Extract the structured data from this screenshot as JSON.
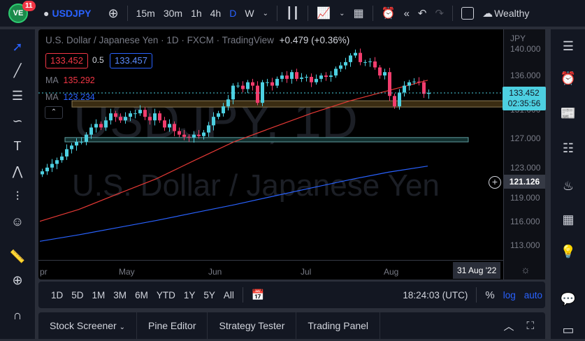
{
  "topbar": {
    "badge": "11",
    "symbol": "USDJPY",
    "intervals": [
      "15m",
      "30m",
      "1h",
      "4h",
      "D",
      "W"
    ],
    "active_interval": "D",
    "user": "Wealthy"
  },
  "legend": {
    "title": "U.S. Dollar / Japanese Yen · 1D · FXCM · TradingView",
    "change": "+0.479 (+0.36%)",
    "bid": "133.452",
    "spread": "0.5",
    "ask": "133.457",
    "ma1_label": "MA",
    "ma1_value": "135.292",
    "ma2_label": "MA",
    "ma2_value": "123.234"
  },
  "watermark": {
    "symbol": "USDJPY, 1D",
    "name": "U.S. Dollar / Japanese Yen"
  },
  "axis": {
    "currency": "JPY",
    "ticks": [
      "140.000",
      "136.000",
      "131.000",
      "127.000",
      "123.000",
      "119.000",
      "116.000",
      "113.000"
    ],
    "last_price": "133.452",
    "countdown": "02:35:56",
    "crosshair_price": "121.126",
    "time_ticks": [
      "pr",
      "May",
      "Jun",
      "Jul",
      "Aug"
    ],
    "time_cursor": "31 Aug '22"
  },
  "rangebar": {
    "ranges": [
      "1D",
      "5D",
      "1M",
      "3M",
      "6M",
      "YTD",
      "1Y",
      "5Y",
      "All"
    ],
    "clock": "18:24:03 (UTC)",
    "percent": "%",
    "log": "log",
    "auto": "auto"
  },
  "tabs": [
    "Stock Screener",
    "Pine Editor",
    "Strategy Tester",
    "Trading Panel"
  ],
  "chart_data": {
    "type": "candlestick",
    "symbol": "USDJPY",
    "timeframe": "1D",
    "colors": {
      "up": "#4dd0e1",
      "down": "#f23d6d",
      "ma_fast": "#e53935",
      "ma_slow": "#2962ff"
    },
    "closes": [
      122.5,
      123,
      123.5,
      124,
      124.5,
      125.5,
      126,
      126.5,
      126.5,
      127.5,
      128.5,
      129,
      128.5,
      129.5,
      130.5,
      130,
      129.5,
      130,
      130.5,
      130.5,
      131,
      130,
      129.5,
      130.5,
      129.5,
      128.5,
      129,
      128,
      127.5,
      127.2,
      127.1,
      127.5,
      127.3,
      127.8,
      128.8,
      130,
      130.5,
      131.5,
      132.5,
      134.5,
      134.5,
      134,
      135,
      134.5,
      132,
      135,
      135,
      134.5,
      135.5,
      136,
      135.5,
      136.5,
      135.5,
      135.7,
      135.8,
      135,
      135.5,
      136,
      135.8,
      136,
      137,
      137.5,
      138,
      139,
      139.4,
      138,
      138,
      138.1,
      137.2,
      136,
      136.5,
      133,
      131.5,
      133.5,
      134.5,
      135,
      135.1,
      135,
      133.3,
      133.45
    ],
    "ma_fast": [
      116,
      117.5,
      119.5,
      121.5,
      124,
      126.5,
      128.5,
      130.5,
      132.3,
      133.8,
      135.3
    ],
    "ma_slow": [
      113.5,
      114.3,
      115.2,
      116.1,
      117.1,
      118.1,
      119.2,
      120.3,
      121.4,
      122.4,
      123.2
    ],
    "zones": [
      [
        131.4,
        132.3
      ],
      [
        126.5,
        127.1
      ]
    ]
  }
}
